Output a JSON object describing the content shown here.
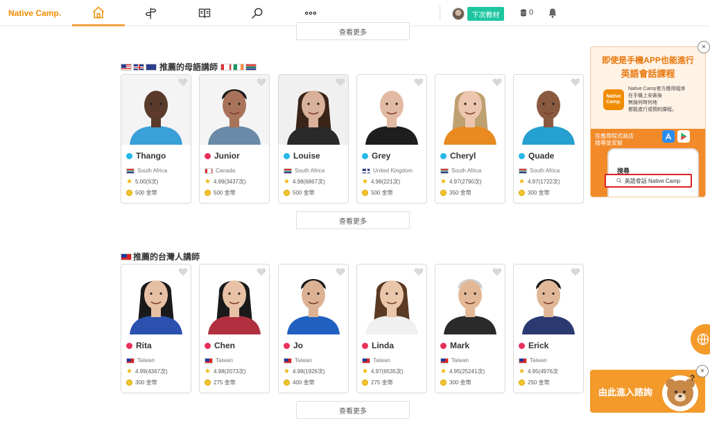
{
  "header": {
    "logo": "Native Camp.",
    "next_lesson_label": "下次教材",
    "coin_count": "0",
    "nav": [
      {
        "icon": "home-icon",
        "active": true
      },
      {
        "icon": "signpost-icon",
        "active": false
      },
      {
        "icon": "book-icon",
        "active": false
      },
      {
        "icon": "search-icon",
        "active": false
      },
      {
        "icon": "more-icon",
        "active": false
      }
    ]
  },
  "more_label": "查看更多",
  "native_section": {
    "title": "推薦的母語講師",
    "teachers": [
      {
        "name": "Thango",
        "country": "South Africa",
        "rating": "5.00(9次)",
        "coins": "500 金幣",
        "status_color": "#26b8e8"
      },
      {
        "name": "Junior",
        "country": "Canada",
        "rating": "4.99(3437次)",
        "coins": "500 金幣",
        "status_color": "#e8305a"
      },
      {
        "name": "Louise",
        "country": "South Africa",
        "rating": "4.98(6867次)",
        "coins": "500 金幣",
        "status_color": "#26b8e8"
      },
      {
        "name": "Grey",
        "country": "United Kingdom",
        "rating": "4.98(221次)",
        "coins": "500 金幣",
        "status_color": "#26b8e8"
      },
      {
        "name": "Cheryl",
        "country": "South Africa",
        "rating": "4.97(2790次)",
        "coins": "350 金幣",
        "status_color": "#26b8e8"
      },
      {
        "name": "Quade",
        "country": "South Africa",
        "rating": "4.97(1722次)",
        "coins": "300 金幣",
        "status_color": "#26b8e8"
      }
    ]
  },
  "taiwan_section": {
    "title": "推薦的台灣人講師",
    "teachers": [
      {
        "name": "Rita",
        "country": "Taiwan",
        "rating": "4.99(4367次)",
        "coins": "300 金幣",
        "status_color": "#e8305a"
      },
      {
        "name": "Chen",
        "country": "Taiwan",
        "rating": "4.98(2073次)",
        "coins": "275 金幣",
        "status_color": "#e8305a"
      },
      {
        "name": "Jo",
        "country": "Taiwan",
        "rating": "4.98(1926次)",
        "coins": "400 金幣",
        "status_color": "#e8305a"
      },
      {
        "name": "Linda",
        "country": "Taiwan",
        "rating": "4.97(6535次)",
        "coins": "275 金幣",
        "status_color": "#e8305a"
      },
      {
        "name": "Mark",
        "country": "Taiwan",
        "rating": "4.95(25241次)",
        "coins": "300 金幣",
        "status_color": "#e8305a"
      },
      {
        "name": "Erick",
        "country": "Taiwan",
        "rating": "4.95(4976次",
        "coins": "250 金幣",
        "status_color": "#e8305a"
      }
    ]
  },
  "ad": {
    "title": "即使是手機APP也能進行",
    "subtitle": "英語會話課程",
    "logo_text": "Native Camp.",
    "desc": [
      "Native Camp官方應用程序",
      "在手機上安裝後",
      "無論何時何地",
      "都能進行或預約課程。"
    ],
    "store_text": [
      "在應用程式商店",
      "搜尋並安裝"
    ],
    "phone_search": "搜尋",
    "search_text": "英語會話 Native Camp",
    "close": "×"
  },
  "consult": {
    "label": "由此進入諮詢",
    "close": "×"
  },
  "colors": {
    "accent": "#f08c00",
    "green": "#1ec6a0",
    "orange": "#f39a2a"
  }
}
